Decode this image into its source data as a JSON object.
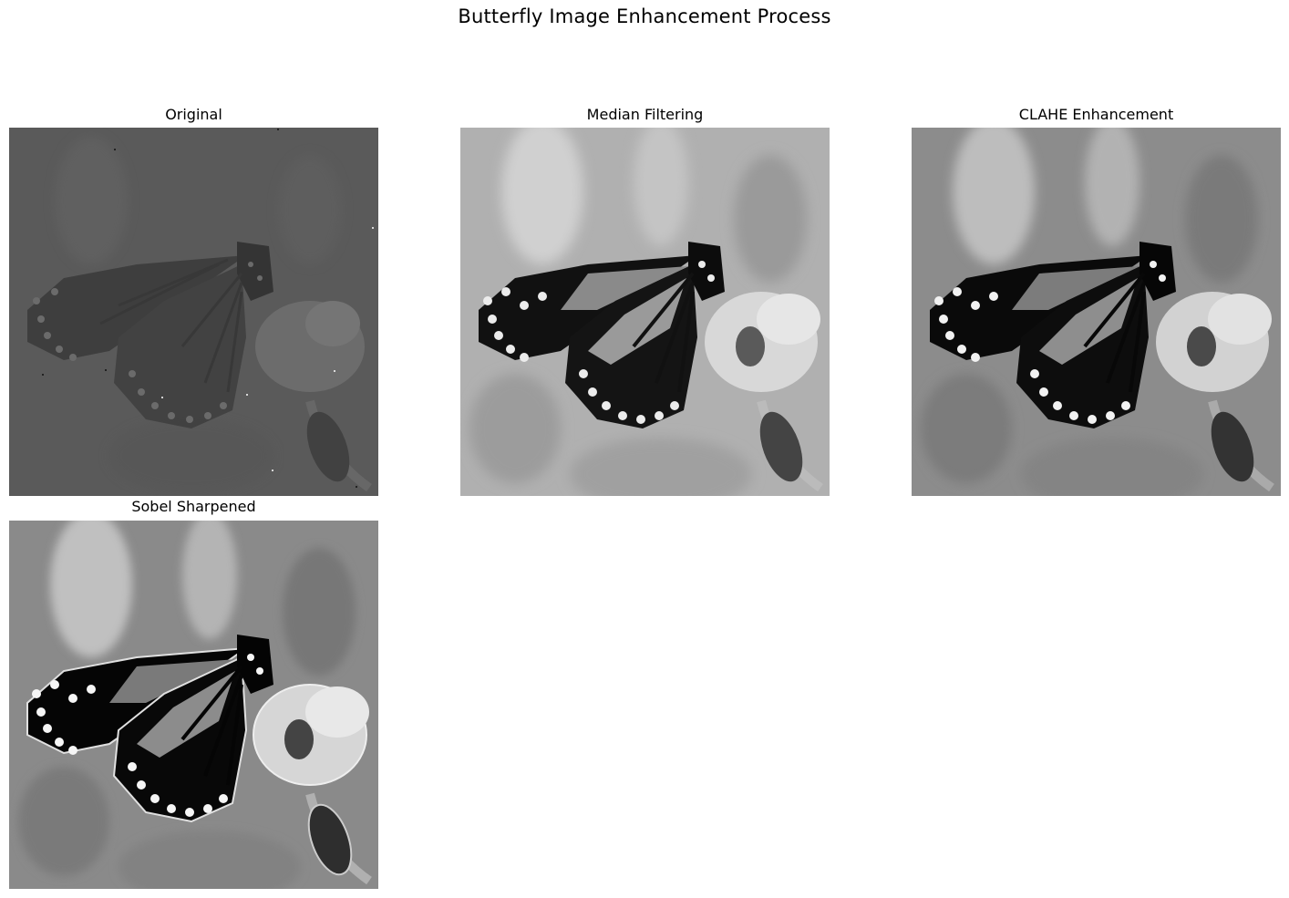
{
  "figure": {
    "title": "Butterfly Image Enhancement Process",
    "panels": [
      {
        "title": "Original",
        "image": "butterfly-grayscale-noisy-low-contrast"
      },
      {
        "title": "Median Filtering",
        "image": "butterfly-grayscale-median-filtered"
      },
      {
        "title": "CLAHE Enhancement",
        "image": "butterfly-grayscale-clahe"
      },
      {
        "title": "Sobel Sharpened",
        "image": "butterfly-grayscale-sobel-sharpened"
      }
    ]
  },
  "colors": {
    "background": "#ffffff",
    "text": "#000000"
  }
}
